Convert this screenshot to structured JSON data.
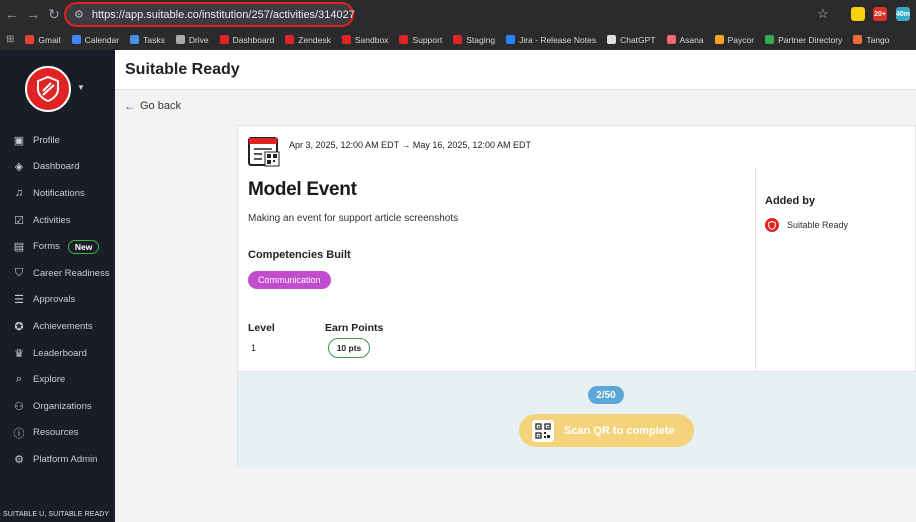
{
  "browser": {
    "url": "https://app.suitable.co/institution/257/activities/314027",
    "extensions": [
      {
        "name": "ext-yellow",
        "label": "",
        "color": "#f5d20a"
      },
      {
        "name": "ext-red",
        "label": "20+",
        "color": "#d93025"
      },
      {
        "name": "ext-timer",
        "label": "40m",
        "color": "#3aa8c9"
      }
    ],
    "bookmarks": [
      {
        "label": "Gmail",
        "color": "#ea4335"
      },
      {
        "label": "Calendar",
        "color": "#4285f4"
      },
      {
        "label": "Tasks",
        "color": "#4a90e2"
      },
      {
        "label": "Drive",
        "color": "#aaaaaa"
      },
      {
        "label": "Dashboard",
        "color": "#e02424"
      },
      {
        "label": "Zendesk",
        "color": "#e02424"
      },
      {
        "label": "Sandbox",
        "color": "#e02424"
      },
      {
        "label": "Support",
        "color": "#e02424"
      },
      {
        "label": "Staging",
        "color": "#e02424"
      },
      {
        "label": "Jira - Release Notes",
        "color": "#2684ff"
      },
      {
        "label": "ChatGPT",
        "color": "#dddddd"
      },
      {
        "label": "Asana",
        "color": "#f06a6a"
      },
      {
        "label": "Paycor",
        "color": "#f5a623"
      },
      {
        "label": "Partner Directory",
        "color": "#34a853"
      },
      {
        "label": "Tango",
        "color": "#f26b3a"
      }
    ]
  },
  "sidebar": {
    "items": [
      {
        "label": "Profile",
        "icon": "profile-icon",
        "glyph": "▣"
      },
      {
        "label": "Dashboard",
        "icon": "dashboard-icon",
        "glyph": "◈"
      },
      {
        "label": "Notifications",
        "icon": "bell-icon",
        "glyph": "♫"
      },
      {
        "label": "Activities",
        "icon": "checkbox-icon",
        "glyph": "☑"
      },
      {
        "label": "Forms",
        "icon": "form-icon",
        "glyph": "▤"
      },
      {
        "label": "Career Readiness",
        "icon": "shield-icon",
        "glyph": "⛉"
      },
      {
        "label": "Approvals",
        "icon": "list-check-icon",
        "glyph": "☰"
      },
      {
        "label": "Achievements",
        "icon": "medal-icon",
        "glyph": "✪"
      },
      {
        "label": "Leaderboard",
        "icon": "trophy-icon",
        "glyph": "♛"
      },
      {
        "label": "Explore",
        "icon": "compass-icon",
        "glyph": "⌕"
      },
      {
        "label": "Organizations",
        "icon": "people-icon",
        "glyph": "⚇"
      },
      {
        "label": "Resources",
        "icon": "info-icon",
        "glyph": "ⓘ"
      },
      {
        "label": "Platform Admin",
        "icon": "gear-icon",
        "glyph": "⚙"
      }
    ],
    "new_badge": "New",
    "footer": "SUITABLE U, SUITABLE READY"
  },
  "header": {
    "title": "Suitable Ready"
  },
  "go_back": "Go back",
  "event": {
    "date_range": "Apr 3, 2025, 12:00 AM EDT → May 16, 2025, 12:00 AM EDT",
    "title": "Model Event",
    "description": "Making an event for support article screenshots",
    "competencies_heading": "Competencies Built",
    "competency": "Communication",
    "level_label": "Level",
    "level_value": "1",
    "points_label": "Earn Points",
    "points_value": "10 pts",
    "added_by_label": "Added by",
    "added_by_name": "Suitable Ready"
  },
  "footer": {
    "progress": "2/50",
    "scan_button": "Scan QR to complete"
  },
  "colors": {
    "brand_red": "#e02424",
    "sidebar_bg": "#1a1d28",
    "competency_chip": "#c34bd0",
    "scan_button": "#f4d37a",
    "progress_badge": "#5aa7d8"
  }
}
